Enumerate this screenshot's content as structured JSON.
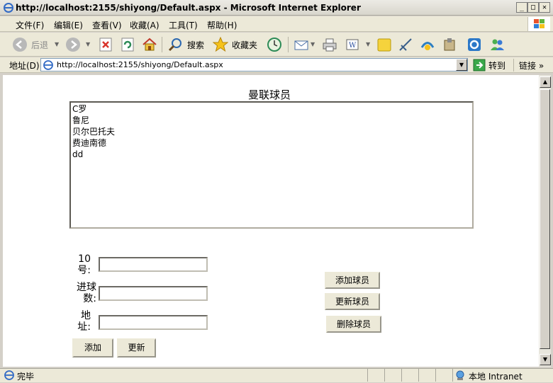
{
  "window": {
    "title": "http://localhost:2155/shiyong/Default.aspx - Microsoft Internet Explorer",
    "minimize_glyph": "_",
    "maximize_glyph": "□",
    "close_glyph": "✕"
  },
  "menu": [
    "文件(F)",
    "编辑(E)",
    "查看(V)",
    "收藏(A)",
    "工具(T)",
    "帮助(H)"
  ],
  "toolbar": {
    "back_label": "后退",
    "search_label": "搜索",
    "favorites_label": "收藏夹"
  },
  "address": {
    "label": "地址(D)",
    "url": "http://localhost:2155/shiyong/Default.aspx",
    "go_label": "转到",
    "links_label": "链接 »"
  },
  "page": {
    "title": "曼联球员",
    "players": [
      "C罗",
      "鲁尼",
      "贝尔巴托夫",
      "费迪南德",
      "dd"
    ],
    "form": {
      "number_label_1": "10",
      "number_label_2": "号:",
      "goals_label_1": "进球",
      "goals_label_2": "数:",
      "address_label_1": "地",
      "address_label_2": "址:",
      "number_value": "",
      "goals_value": "",
      "address_value": ""
    },
    "buttons": {
      "add": "添加",
      "update": "更新",
      "add_player": "添加球员",
      "update_player": "更新球员",
      "delete_player": "删除球员"
    }
  },
  "status": {
    "text": "完毕",
    "zone": "本地 Intranet"
  },
  "colors": {
    "back_icon": "#b8b8b8",
    "refresh_icon": "#2e8b57",
    "stop_icon": "#d9352b",
    "accent": "#316ac5"
  }
}
